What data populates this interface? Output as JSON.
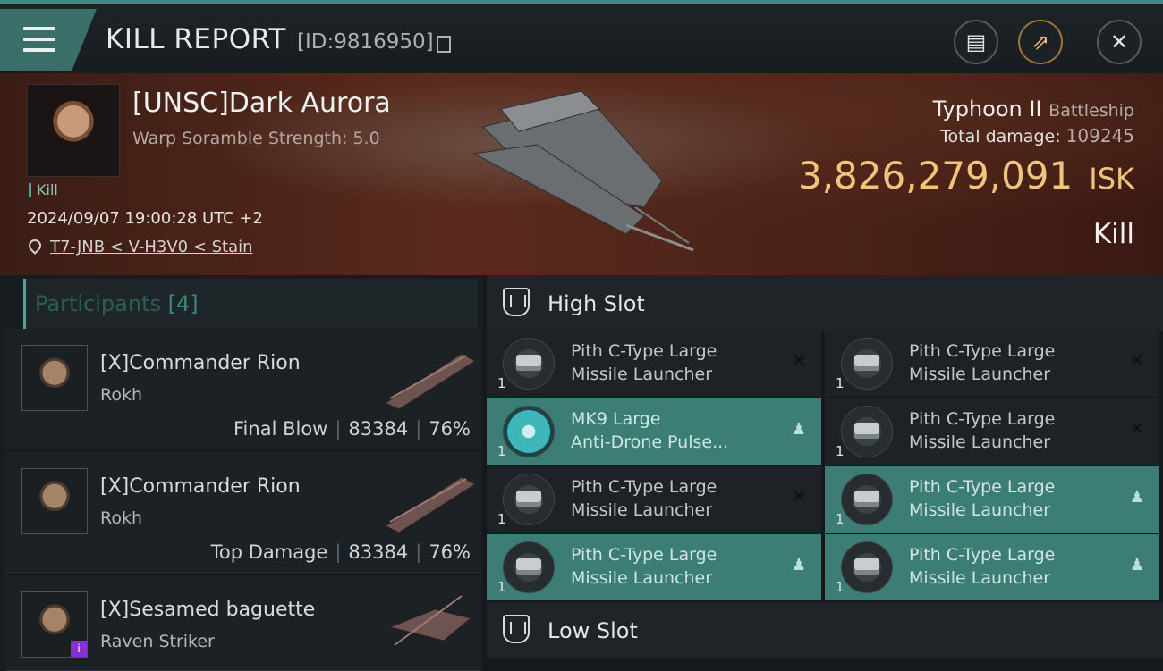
{
  "header": {
    "title": "KILL REPORT",
    "report_id": "[ID:9816950]"
  },
  "victim": {
    "pilot_name": "[UNSC]Dark Aurora",
    "warp_scramble": "Warp Soramble Strength: 5.0",
    "event_tag": "Kill",
    "datetime": "2024/09/07 19:00:28 UTC +2",
    "location": "T7-JNB < V-H3V0 < Stain",
    "ship_name": "Typhoon II",
    "ship_class": "Battleship",
    "total_damage_label": "Total damage:",
    "total_damage_value": "109245",
    "isk_value": "3,826,279,091",
    "isk_unit": "ISK",
    "result": "Kill"
  },
  "participants": {
    "label": "Participants",
    "count": "[4]",
    "items": [
      {
        "name": "[X]Commander Rion",
        "ship": "Rokh",
        "role": "Final Blow",
        "damage": "83384",
        "percent": "76%"
      },
      {
        "name": "[X]Commander Rion",
        "ship": "Rokh",
        "role": "Top Damage",
        "damage": "83384",
        "percent": "76%"
      },
      {
        "name": "[X]Sesamed baguette",
        "ship": "Raven Striker",
        "role": "",
        "damage": "",
        "percent": ""
      }
    ]
  },
  "high_slot": {
    "title": "High Slot",
    "modules": [
      {
        "line1": "Pith C-Type Large",
        "line2": "Missile Launcher",
        "qty": "1",
        "status": "destroyed",
        "icon": "launcher"
      },
      {
        "line1": "Pith C-Type Large",
        "line2": "Missile Launcher",
        "qty": "1",
        "status": "destroyed",
        "icon": "launcher"
      },
      {
        "line1": "MK9 Large",
        "line2": "Anti-Drone Pulse...",
        "qty": "1",
        "status": "dropped",
        "icon": "pulse"
      },
      {
        "line1": "Pith C-Type Large",
        "line2": "Missile Launcher",
        "qty": "1",
        "status": "destroyed",
        "icon": "launcher"
      },
      {
        "line1": "Pith C-Type Large",
        "line2": "Missile Launcher",
        "qty": "1",
        "status": "destroyed",
        "icon": "launcher"
      },
      {
        "line1": "Pith C-Type Large",
        "line2": "Missile Launcher",
        "qty": "1",
        "status": "dropped",
        "icon": "launcher"
      },
      {
        "line1": "Pith C-Type Large",
        "line2": "Missile Launcher",
        "qty": "1",
        "status": "dropped",
        "icon": "launcher"
      },
      {
        "line1": "Pith C-Type Large",
        "line2": "Missile Launcher",
        "qty": "1",
        "status": "dropped",
        "icon": "launcher"
      }
    ]
  },
  "low_slot": {
    "title": "Low Slot"
  },
  "colors": {
    "accent_teal": "#3c7d75",
    "isk_gold": "#f0c57a"
  }
}
